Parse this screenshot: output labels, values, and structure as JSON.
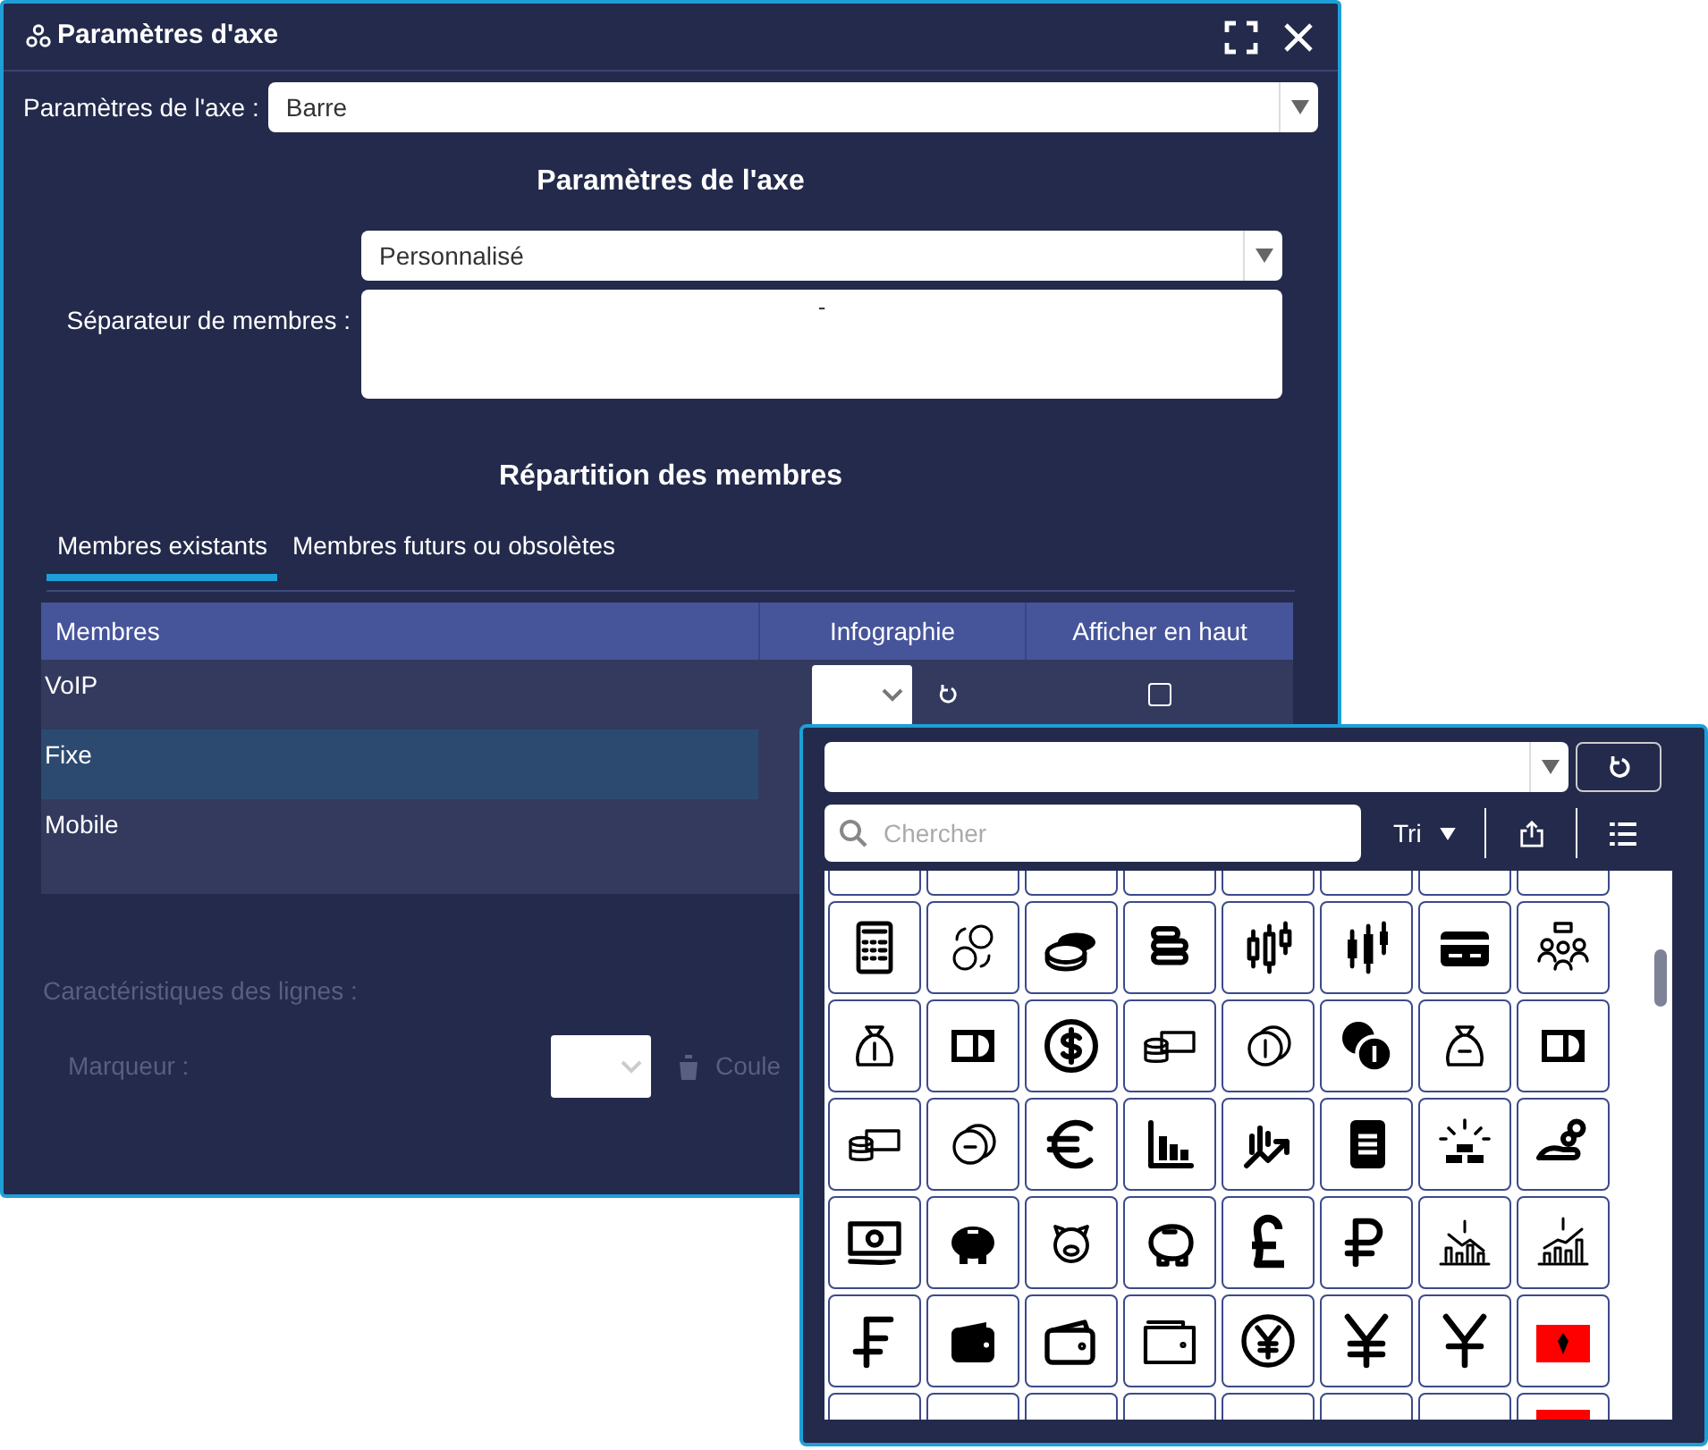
{
  "window": {
    "title": "Paramètres d'axe"
  },
  "axis_type": {
    "label": "Paramètres de l'axe :",
    "value": "Barre"
  },
  "section_title": "Paramètres de l'axe",
  "separator": {
    "label": "Séparateur de membres :",
    "preset": "Personnalisé",
    "value": "-"
  },
  "distribution_title": "Répartition des membres",
  "tabs": [
    {
      "label": "Membres existants",
      "selected": true
    },
    {
      "label": "Membres futurs ou obsolètes",
      "selected": false
    }
  ],
  "table": {
    "columns": [
      "Membres",
      "Infographie",
      "Afficher en haut"
    ],
    "rows": [
      {
        "name": "VoIP",
        "selected": false,
        "show_on_top": false
      },
      {
        "name": "Fixe",
        "selected": true
      },
      {
        "name": "Mobile",
        "selected": false
      }
    ]
  },
  "line_settings": {
    "title": "Caractéristiques des lignes :",
    "marker_label": "Marqueur :",
    "color_label": "Coule",
    "disabled": true
  },
  "icon_picker": {
    "search_placeholder": "Chercher",
    "sort_label": "Tri"
  }
}
